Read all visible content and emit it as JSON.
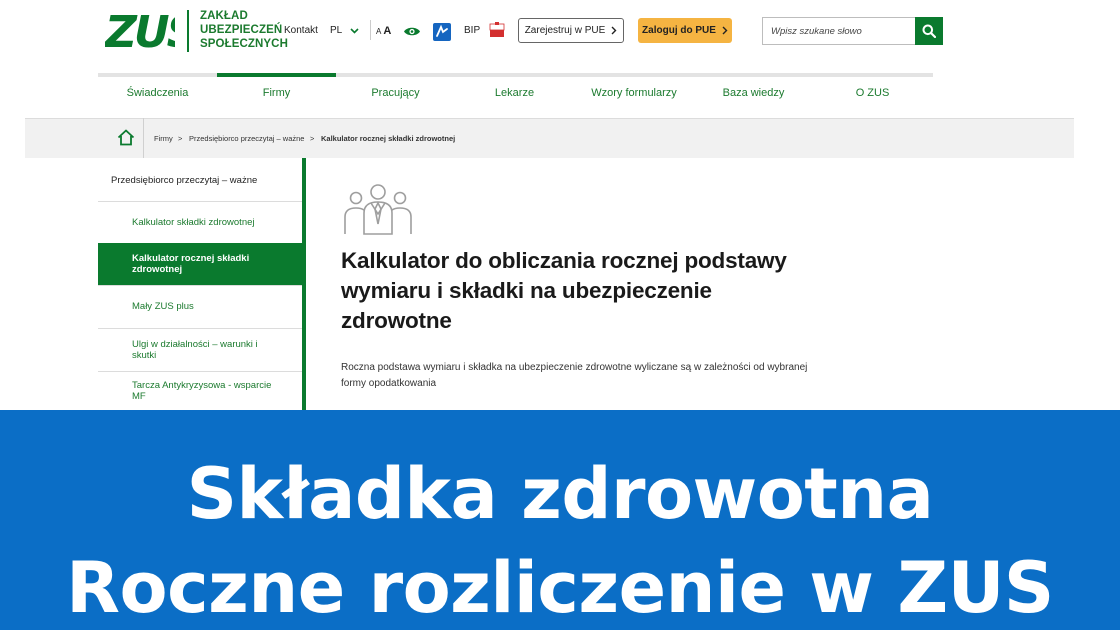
{
  "header": {
    "logo_mark": "ZUS",
    "logo_lines": [
      "ZAKŁAD",
      "UBEZPIECZEŃ",
      "SPOŁECZNYCH"
    ],
    "contact": "Kontakt",
    "language": "PL",
    "font_size_small": "A",
    "font_size_large": "A",
    "bip": "BIP",
    "register_button": "Zarejestruj w PUE",
    "login_button": "Zaloguj do PUE",
    "search_placeholder": "Wpisz szukane słowo",
    "brand_color": "#0a7a2e",
    "login_color": "#f5b442"
  },
  "nav": {
    "items": [
      {
        "label": "Świadczenia"
      },
      {
        "label": "Firmy"
      },
      {
        "label": "Pracujący"
      },
      {
        "label": "Lekarze"
      },
      {
        "label": "Wzory formularzy"
      },
      {
        "label": "Baza wiedzy"
      },
      {
        "label": "O ZUS"
      }
    ],
    "active": "Firmy"
  },
  "breadcrumb": {
    "items": [
      "Firmy",
      "Przedsiębiorco przeczytaj – ważne",
      "Kalkulator rocznej składki zdrowotnej"
    ],
    "separator": ">"
  },
  "sidebar": {
    "heading": "Przedsiębiorco przeczytaj – ważne",
    "items": [
      {
        "label": "Kalkulator składki zdrowotnej"
      },
      {
        "label": "Kalkulator rocznej składki zdrowotnej"
      },
      {
        "label": "Mały ZUS plus"
      },
      {
        "label": "Ulgi w działalności – warunki i skutki"
      },
      {
        "label": "Tarcza Antykryzysowa - wsparcie MF"
      }
    ],
    "active_index": 1
  },
  "main": {
    "icon": "people-group-icon",
    "title": "Kalkulator do obliczania rocznej podstawy wymiaru i składki na ubezpieczenie zdrowotne",
    "description": "Roczna podstawa wymiaru i składka na ubezpieczenie zdrowotne wyliczane są w zależności od wybranej formy opodatkowania"
  },
  "banner": {
    "line1": "Składka zdrowotna",
    "line2": "Roczne rozliczenie w ZUS",
    "color": "#0b6ec6"
  }
}
